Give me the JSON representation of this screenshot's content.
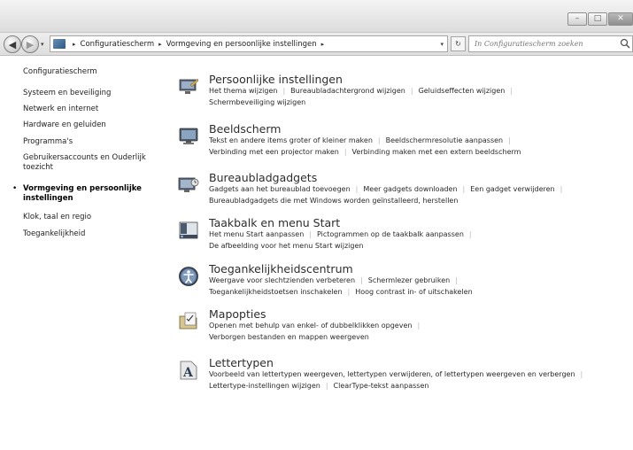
{
  "window": {
    "min": "–",
    "max": "□",
    "close": "✕"
  },
  "nav": {
    "back": "◀",
    "forward": "▶",
    "dropdown": "▾",
    "breadcrumb": [
      "Configuratiescherm",
      "Vormgeving en persoonlijke instellingen"
    ],
    "separator": "▸",
    "refresh": "↻",
    "search_placeholder": "In Configuratiescherm zoeken"
  },
  "sidebar": {
    "items": [
      {
        "label": "Configuratiescherm",
        "active": false
      },
      {
        "label": "Systeem en beveiliging",
        "active": false
      },
      {
        "label": "Netwerk en internet",
        "active": false
      },
      {
        "label": "Hardware en geluiden",
        "active": false
      },
      {
        "label": "Programma's",
        "active": false
      },
      {
        "label": "Gebruikersaccounts en Ouderlijk toezicht",
        "active": false
      },
      {
        "label": "Vormgeving en persoonlijke instellingen",
        "active": true
      },
      {
        "label": "Klok, taal en regio",
        "active": false
      },
      {
        "label": "Toegankelijkheid",
        "active": false
      }
    ],
    "bullet": "•"
  },
  "categories": [
    {
      "icon": "personalization-icon",
      "title": "Persoonlijke instellingen",
      "lines": [
        [
          "Het thema wijzigen",
          "Bureaubladachtergrond wijzigen",
          "Geluidseffecten wijzigen",
          ""
        ],
        [
          "Schermbeveiliging wijzigen"
        ]
      ]
    },
    {
      "icon": "display-icon",
      "title": "Beeldscherm",
      "lines": [
        [
          "Tekst en andere items groter of kleiner maken",
          "Beeldschermresolutie aanpassen",
          ""
        ],
        [
          "Verbinding met een projector maken",
          "Verbinding maken met een extern beeldscherm"
        ]
      ]
    },
    {
      "icon": "gadgets-icon",
      "title": "Bureaubladgadgets",
      "lines": [
        [
          "Gadgets aan het bureaublad toevoegen",
          "Meer gadgets downloaden",
          "Een gadget verwijderen",
          ""
        ],
        [
          "Bureaubladgadgets die met Windows worden geïnstalleerd, herstellen"
        ]
      ]
    },
    {
      "icon": "taskbar-icon",
      "title": "Taakbalk en menu Start",
      "lines": [
        [
          "Het menu Start aanpassen",
          "Pictogrammen op de taakbalk aanpassen",
          ""
        ],
        [
          "De afbeelding voor het menu Start wijzigen"
        ]
      ]
    },
    {
      "icon": "ease-of-access-icon",
      "title": "Toegankelijkheidscentrum",
      "lines": [
        [
          "Weergave voor slechtzienden verbeteren",
          "Schermlezer gebruiken",
          ""
        ],
        [
          "Toegankelijkheidstoetsen inschakelen",
          "Hoog contrast in- of uitschakelen"
        ]
      ]
    },
    {
      "icon": "folder-options-icon",
      "title": "Mapopties",
      "lines": [
        [
          "Openen met behulp van enkel- of dubbelklikken opgeven",
          ""
        ],
        [
          "Verborgen bestanden en mappen weergeven"
        ]
      ]
    },
    {
      "icon": "fonts-icon",
      "title": "Lettertypen",
      "lines": [
        [
          "Voorbeeld van lettertypen weergeven, lettertypen verwijderen, of lettertypen weergeven en verbergen",
          ""
        ],
        [
          "Lettertype-instellingen wijzigen",
          "ClearType-tekst aanpassen"
        ]
      ]
    }
  ]
}
